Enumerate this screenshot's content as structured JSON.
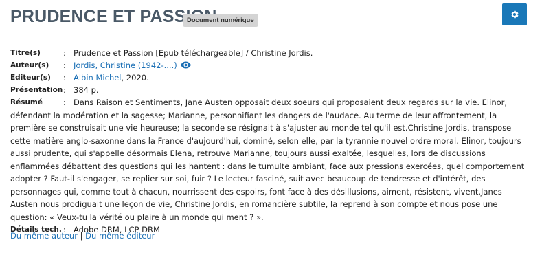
{
  "record": {
    "title": "PRUDENCE ET PASSION",
    "badge": "Document numérique"
  },
  "fields": {
    "titre_label": "Titre(s)",
    "titre_value": "Prudence et Passion [Epub téléchargeable] / Christine Jordis.",
    "auteur_label": "Auteur(s)",
    "auteur_value": "Jordis, Christine (1942-....)",
    "editeur_label": "Editeur(s)",
    "editeur_value": "Albin Michel",
    "editeur_year": ", 2020.",
    "presentation_label": "Présentation",
    "presentation_value": "384 p.",
    "resume_label": "Résumé",
    "resume_value": "Dans Raison et Sentiments, Jane Austen opposait deux soeurs qui proposaient deux regards sur la vie. Elinor, défendant la modération et la sagesse; Marianne, personnifiant les dangers de l'audace. Au terme de leur affrontement, la première se construisait une vie heureuse; la seconde se résignait à s'ajuster au monde tel qu'il est.Christine Jordis, transpose cette matière anglo-saxonne dans la France d'aujourd'hui, dominé, selon elle, par la tyrannie nouvel ordre moral. Elinor, toujours aussi prudente, qui s'appelle désormais Elena, retrouve Marianne, toujours aussi exaltée, lesquelles, lors de discussions enflammées débattent des questions qui les hantent : dans le tumulte ambiant, face aux pressions exercées, quel comportement adopter ? Faut-il s'engager, se replier sur soi, fuir ? Le lecteur fasciné, suit avec beaucoup de tendresse et d'intérêt, des personnages qui, comme tout à chacun, nourrissent des espoirs, font face à des désillusions, aiment, résistent, vivent.Janes Austen nous prodiguait une leçon de vie, Christine Jordis, en romancière subtile, la reprend à son compte et nous pose une question: « Veux-tu la vérité ou plaire à un monde qui ment ? ».",
    "details_label": "Détails tech.",
    "details_value": "Adobe DRM, LCP DRM",
    "colon": ":"
  },
  "links": {
    "same_author": "Du même auteur",
    "separator": "|",
    "same_publisher": "Du même éditeur"
  },
  "icons": {
    "settings": "gear-icon",
    "view": "eye-icon"
  },
  "colors": {
    "title": "#4a5967",
    "link": "#1a6fb5",
    "button": "#1a78b8",
    "badge_bg": "#d4d4d4"
  }
}
